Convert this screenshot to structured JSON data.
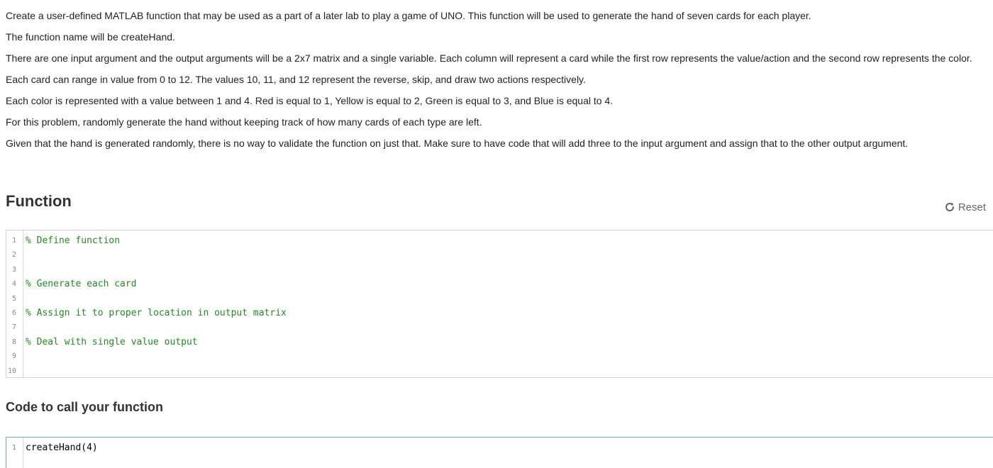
{
  "description": [
    "Create a user-defined MATLAB function that may be used as a part of a later lab to play a game of UNO. This function will be used to generate the hand of seven cards for each player.",
    "The function name will be createHand.",
    "There are one input argument and the output arguments will be a 2x7 matrix and a single variable. Each column will represent a card while the first row represents the value/action and the second row represents the color.",
    "Each card can range in value from 0 to 12. The values 10, 11, and 12 represent the reverse, skip, and draw two actions respectively.",
    "Each color is represented with a value between 1 and 4. Red is equal to 1, Yellow is equal to 2, Green is equal to 3, and Blue is equal to 4.",
    "For this problem, randomly generate the hand without keeping track of how many cards of each type are left.",
    "Given that the hand is generated randomly, there is no way to validate the function on just that. Make sure to have code that will add three to the input argument and assign that to the other output argument."
  ],
  "function_section": {
    "title": "Function",
    "reset_label": "Reset",
    "reset_icon": "refresh-icon",
    "lines": [
      {
        "num": "1",
        "text": "% Define function"
      },
      {
        "num": "2",
        "text": ""
      },
      {
        "num": "3",
        "text": ""
      },
      {
        "num": "4",
        "text": "% Generate each card"
      },
      {
        "num": "5",
        "text": ""
      },
      {
        "num": "6",
        "text": "% Assign it to proper location in output matrix"
      },
      {
        "num": "7",
        "text": ""
      },
      {
        "num": "8",
        "text": "% Deal with single value output"
      },
      {
        "num": "9",
        "text": ""
      },
      {
        "num": "10",
        "text": ""
      }
    ]
  },
  "call_section": {
    "title": "Code to call your function",
    "lines": [
      {
        "num": "1",
        "text": "createHand(4)"
      }
    ]
  },
  "colors": {
    "comment": "#228b22",
    "editor_focus_border": "#6ea6d9"
  }
}
